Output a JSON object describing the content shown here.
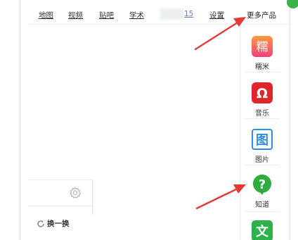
{
  "nav": {
    "map": "地图",
    "video": "视频",
    "tieba": "贴吧",
    "xueshu": "学术",
    "blurred_tail": "15",
    "settings": "设置",
    "more_products": "更多产品"
  },
  "sidebar": {
    "items": [
      {
        "label": "糯米",
        "icon": "nuomi-icon",
        "glyph": "糯",
        "color": "#f05a7e"
      },
      {
        "label": "音乐",
        "icon": "music-icon",
        "glyph": "Ω",
        "color": "#e0262a"
      },
      {
        "label": "图片",
        "icon": "image-icon",
        "glyph": "图",
        "color": "#2f8de4"
      },
      {
        "label": "知道",
        "icon": "zhidao-icon",
        "glyph": "?",
        "color": "#2fab3f"
      },
      {
        "label": "",
        "icon": "wenku-icon",
        "glyph": "文",
        "color": "#2eb14b"
      }
    ]
  },
  "panel": {
    "refresh_label": "换一换"
  },
  "colors": {
    "annotation_arrow": "#e53935"
  }
}
